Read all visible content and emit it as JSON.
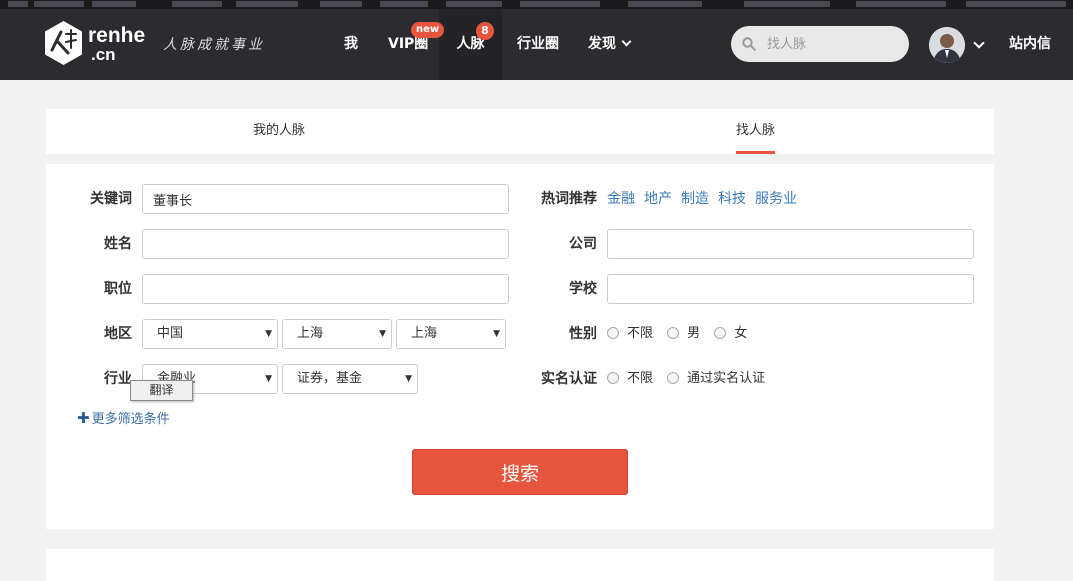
{
  "header": {
    "logo_text": "renhe",
    "logo_sub": ".cn",
    "slogan": "人脉成就事业",
    "nav": [
      {
        "label": "我"
      },
      {
        "label": "VIP圈"
      },
      {
        "label": "人脉"
      },
      {
        "label": "行业圈"
      },
      {
        "label": "发现"
      }
    ],
    "vip_badge": "new",
    "renmai_count": "8",
    "search_placeholder": "找人脉",
    "inbox_label": "站内信"
  },
  "tabs": {
    "mine": "我的人脉",
    "find": "找人脉"
  },
  "form": {
    "keyword_label": "关键词",
    "keyword_value": "董事长",
    "name_label": "姓名",
    "name_value": "",
    "position_label": "职位",
    "position_value": "",
    "region_label": "地区",
    "region": {
      "country": "中国",
      "province": "上海",
      "city": "上海"
    },
    "industry_label": "行业",
    "industry": {
      "main": "金融业",
      "sub": "证券，基金"
    },
    "hot_label": "热词推荐",
    "hot_words": [
      "金融",
      "地产",
      "制造",
      "科技",
      "服务业"
    ],
    "company_label": "公司",
    "company_value": "",
    "school_label": "学校",
    "school_value": "",
    "gender_label": "性别",
    "gender_options": [
      "不限",
      "男",
      "女"
    ],
    "verify_label": "实名认证",
    "verify_options": [
      "不限",
      "通过实名认证"
    ],
    "more_filters": "更多筛选条件",
    "search_button": "搜索"
  },
  "translate_popup": "翻译",
  "colors": {
    "header_bg": "#2b2b30",
    "accent": "#e8553e",
    "link": "#3a7ab7"
  }
}
